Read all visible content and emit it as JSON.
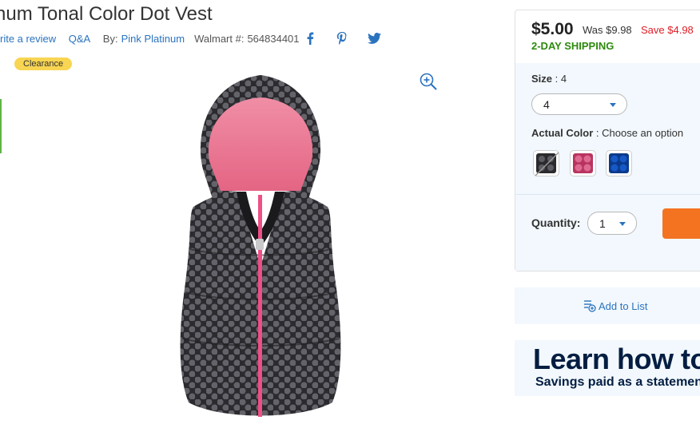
{
  "product": {
    "title": "num Tonal Color Dot Vest",
    "write_review": "rite a review",
    "qa": "Q&A",
    "by_label": "By:",
    "brand": "Pink Platinum",
    "walmart_no_label": "Walmart #:",
    "walmart_no": "564834401",
    "badge": "Clearance",
    "image_icon": "polka-dot-hooded-vest-image"
  },
  "share": {
    "icons": [
      "facebook-icon",
      "pinterest-icon",
      "twitter-icon"
    ]
  },
  "buybox": {
    "price": "$5.00",
    "was": "Was $9.98",
    "save": "Save $4.98",
    "shipping": "2-DAY SHIPPING",
    "size_label": "Size",
    "size_value": "4",
    "size_select": "4",
    "color_label": "Actual Color",
    "color_value": "Choose an option",
    "quantity_label": "Quantity:",
    "quantity_value": "1"
  },
  "list": {
    "label": "Add to List"
  },
  "promo": {
    "headline": "Learn how to",
    "sub": "Savings paid as a statement"
  },
  "colors": {
    "link": "#2a73be",
    "price_save": "#de1c24",
    "shipping": "#2d8a0e",
    "badge": "#f8d552",
    "add_button": "#f47321",
    "panel": "#f2f8fd",
    "promo_text": "#041e42"
  }
}
